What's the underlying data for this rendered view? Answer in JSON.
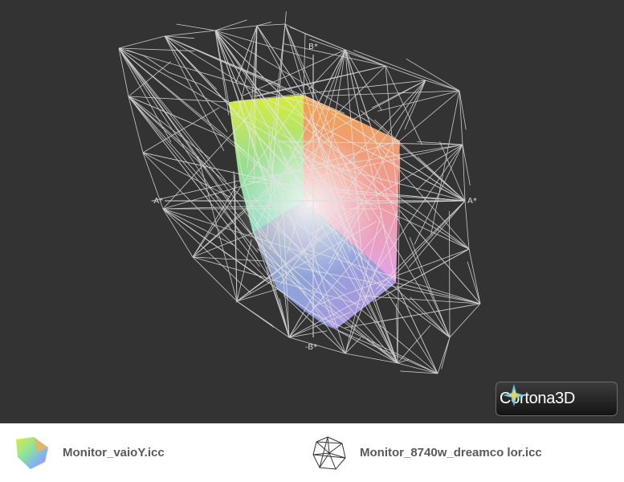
{
  "viewer": {
    "axes": {
      "b_plus": "B*",
      "b_minus": "-B*",
      "a_plus": "A*",
      "a_minus": "-A*"
    },
    "logo": {
      "name": "Cortona",
      "suffix": "3D"
    }
  },
  "legend": {
    "items": [
      {
        "label": "Monitor_vaioY.icc",
        "icon": "solid-gamut-icon"
      },
      {
        "label": "Monitor_8740w_dreamco lor.icc",
        "icon": "wireframe-gamut-icon"
      }
    ]
  },
  "colors": {
    "background": "#333333",
    "wireframe": "#e6e6e6",
    "legend_text": "#5a5a5a"
  }
}
